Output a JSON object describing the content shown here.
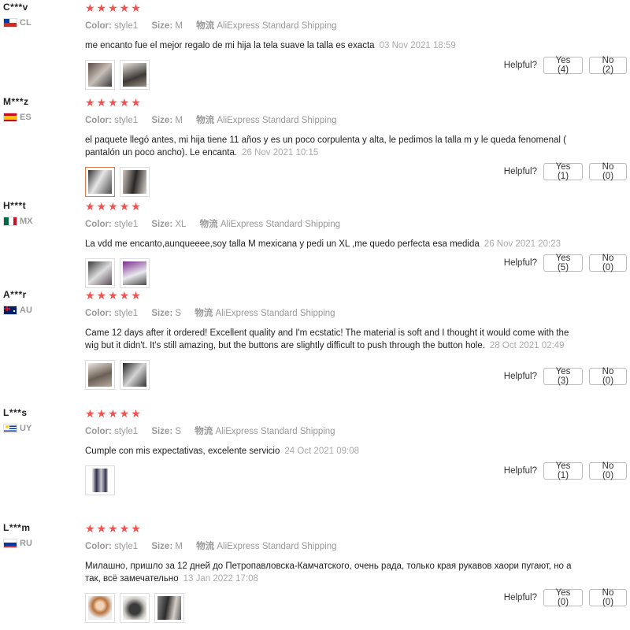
{
  "labels": {
    "color": "Color:",
    "size": "Size:",
    "shipping_key": "物流",
    "helpful": "Helpful?"
  },
  "reviews": [
    {
      "user": "C***v",
      "country": "CL",
      "stars": "★★★★★",
      "color": "style1",
      "size": "M",
      "shipping": "AliExpress Standard Shipping",
      "text": "me encanto fue el mejor regalo de mi hija la tela suave la talla es exacta",
      "date": "03 Nov 2021 18:59",
      "yes": "Yes (4)",
      "no": "No (2)"
    },
    {
      "user": "M***z",
      "country": "ES",
      "stars": "★★★★★",
      "color": "style1",
      "size": "M",
      "shipping": "AliExpress Standard Shipping",
      "text": "el paquete llegó antes, mi hija tiene 11 años y es un poco corpulenta y alta, le pedimos la talla m y le queda fenomenal ( pantalón un poco ancho). Le encanta.",
      "date": "26 Nov 2021 10:15",
      "yes": "Yes (1)",
      "no": "No (0)"
    },
    {
      "user": "H***t",
      "country": "MX",
      "stars": "★★★★★",
      "color": "style1",
      "size": "XL",
      "shipping": "AliExpress Standard Shipping",
      "text": "La vdd me encanto,aunqueeee,soy talla M mexicana y pedi un XL ,me quedo perfecta esa medida",
      "date": "26 Nov 2021 20:23",
      "yes": "Yes (5)",
      "no": "No (0)"
    },
    {
      "user": "A***r",
      "country": "AU",
      "stars": "★★★★★",
      "color": "style1",
      "size": "S",
      "shipping": "AliExpress Standard Shipping",
      "text": "Came 12 days after it ordered! Excellent quality and I'm ecstatic! The material is soft and I thought it would come with the wig but it didn't. It's still amazing, but the buttons are slightly difficult to push through the button hole.",
      "date": "28 Oct 2021 02:49",
      "yes": "Yes (3)",
      "no": "No (0)"
    },
    {
      "user": "L***s",
      "country": "UY",
      "stars": "★★★★★",
      "color": "style1",
      "size": "S",
      "shipping": "AliExpress Standard Shipping",
      "text": "Cumple con mis expectativas, excelente servicio",
      "date": "24 Oct 2021 09:08",
      "yes": "Yes (1)",
      "no": "No (0)"
    },
    {
      "user": "L***m",
      "country": "RU",
      "stars": "★★★★★",
      "color": "style1",
      "size": "M",
      "shipping": "AliExpress Standard Shipping",
      "text": "Милашно, пришло за 12 дней до Петропавловска-Камчатского, очень рада, только края рукавов хаори пугают, но а так, всё замечательно",
      "date": "13 Jan 2022 17:08",
      "yes": "Yes (0)",
      "no": "No (0)"
    }
  ]
}
